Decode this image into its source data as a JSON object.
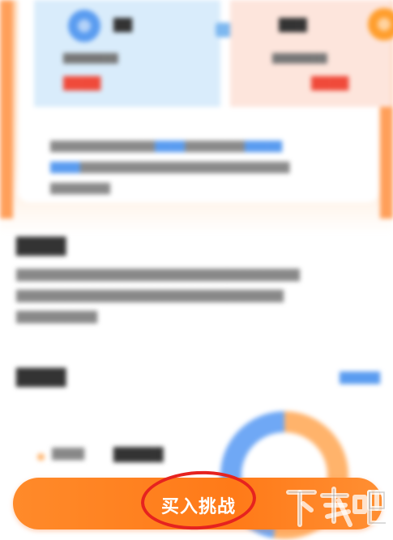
{
  "buy_button": {
    "label": "买入挑战"
  },
  "watermark": {
    "label": "下载吧"
  },
  "colors": {
    "accent": "#ff7a18",
    "highlight": "#e6231f",
    "blue": "#5a9cf0"
  }
}
